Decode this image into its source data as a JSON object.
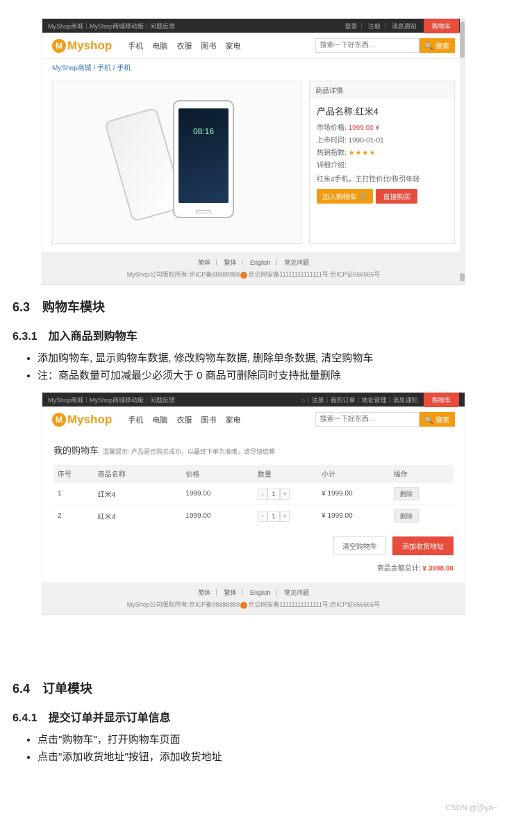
{
  "sec63": {
    "h": "6.3　购物车模块"
  },
  "sec631": {
    "h": "6.3.1　加入商品到购物车"
  },
  "bul1": [
    "添加购物车, 显示购物车数据, 修改购物车数据, 删除单条数据, 清空购物车",
    "注：商品数量可加减最少必须大于 0 商品可删除同时支持批量删除"
  ],
  "sec64": {
    "h": "6.4　订单模块"
  },
  "sec641": {
    "h": "6.4.1　提交订单并显示订单信息"
  },
  "bul2": [
    "点击\"购物车\"，打开购物车页面",
    "点击\"添加收货地址\"按钮，添加收货地址"
  ],
  "top": {
    "links": "MyShop商城｜MyShop商城移动版｜问题反馈",
    "login": "登录",
    "reg": "注册",
    "msg": "消息通知",
    "cart": "购物车",
    "links2": "○｜注册｜我的订单｜地址管理｜消息通知"
  },
  "logo": {
    "m": "M",
    "name": "Myshop"
  },
  "nav": [
    "手机",
    "电脑",
    "衣服",
    "图书",
    "家电"
  ],
  "search": {
    "ph": "搜索一下好东西…",
    "btn": "搜索",
    "icon": "🔍"
  },
  "crumb": {
    "a": "MyShop商城",
    "b": "手机",
    "c": "手机"
  },
  "detail": {
    "head": "商品详情",
    "pname": "产品名称:红米4",
    "mkt_l": "市场价格:",
    "mkt_v": "1999.00",
    "yuan": "¥",
    "date_l": "上市时间:",
    "date_v": "1990-01-01",
    "hot_l": "热销指数:",
    "stars": "★★★★",
    "intro_l": "详细介绍:",
    "desc": "红米4手机，主打性价比!极引年轻",
    "add": "加入购物车",
    "buy": "直接购买",
    "cartIcon": "🛒",
    "time": "08:16"
  },
  "footer": {
    "langs": [
      "简体",
      "繁体",
      "English",
      "常见问题"
    ],
    "cp": "MyShop公司版权所有:京ICP备88888888",
    "beian": "京公网安备11111111111111号:京ICP证666666号"
  },
  "cart": {
    "title": "我的购物车",
    "sub": "温馨提示: 产品是否购买成功，以最终下单为准哦，请尽快结算",
    "cols": [
      "序号",
      "商品名称",
      "价格",
      "数量",
      "小计",
      "操作"
    ],
    "rows": [
      {
        "i": "1",
        "n": "红米4",
        "p": "1999.00",
        "q": "1",
        "s": "¥ 1999.00"
      },
      {
        "i": "2",
        "n": "红米4",
        "p": "1999.00",
        "q": "1",
        "s": "¥ 1999.00"
      }
    ],
    "minus": "-",
    "plus": "+",
    "del": "删除",
    "clear": "清空购物车",
    "addr": "添加收货地址",
    "total_l": "商品金额总计:",
    "total_v": "¥  3998.00"
  },
  "wm": "CSDN @汐ya~"
}
